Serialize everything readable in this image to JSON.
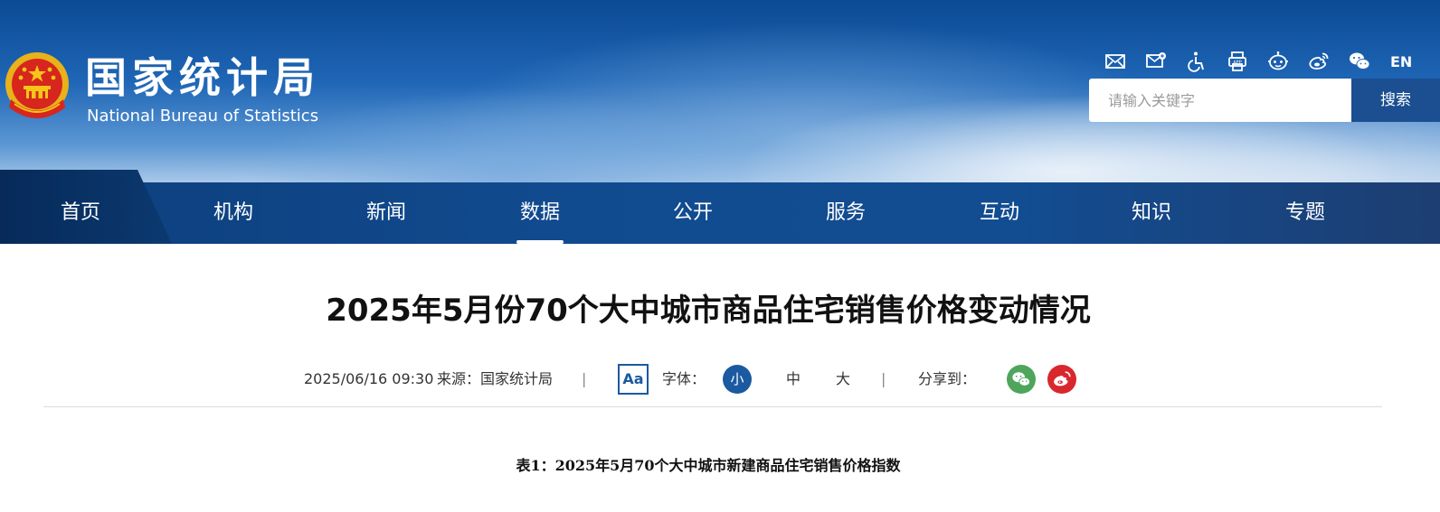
{
  "header": {
    "site_name_cn": "国家统计局",
    "site_name_en": "National Bureau of Statistics",
    "tools": {
      "icons": [
        "mail-icon",
        "mail-settings-icon",
        "accessibility-icon",
        "app-icon",
        "robot-icon",
        "weibo-icon",
        "wechat-icon"
      ],
      "language_label": "EN"
    },
    "search": {
      "placeholder": "请输入关键字",
      "value": "",
      "button_label": "搜索"
    }
  },
  "nav": {
    "items": [
      {
        "label": "首页"
      },
      {
        "label": "机构"
      },
      {
        "label": "新闻"
      },
      {
        "label": "数据"
      },
      {
        "label": "公开"
      },
      {
        "label": "服务"
      },
      {
        "label": "互动"
      },
      {
        "label": "知识"
      },
      {
        "label": "专题"
      }
    ],
    "active": "数据"
  },
  "article": {
    "title": "2025年5月份70个大中城市商品住宅销售价格变动情况",
    "meta": {
      "datetime": "2025/06/16 09:30",
      "source": "来源：国家统计局",
      "separator": "|",
      "font_icon_label": "Aa",
      "font_label": "字体：",
      "font_sizes": [
        "小",
        "中",
        "大"
      ],
      "share_label": "分享到："
    },
    "table_caption": "表1：2025年5月70个大中城市新建商品住宅销售价格指数"
  },
  "colors": {
    "nav_bg": "#124d92",
    "accent_blue": "#1b5aa0",
    "search_button": "#1b4f91",
    "wechat_green": "#4fa55b",
    "weibo_red": "#d9272e"
  }
}
